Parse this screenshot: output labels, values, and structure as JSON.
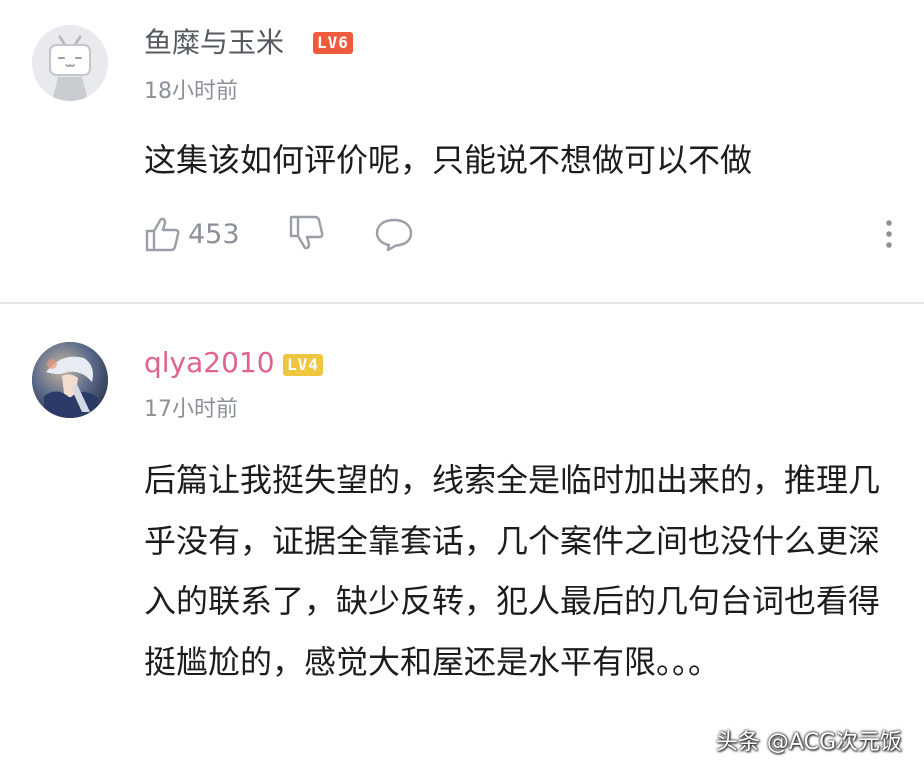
{
  "comments": [
    {
      "username": "鱼糜与玉米",
      "level": "LV6",
      "level_color": "#ef5b3c",
      "username_color": "#555a61",
      "avatar_icon": "bilibili-tv-avatar-icon",
      "timestamp": "18小时前",
      "text": "这集该如何评价呢，只能说不想做可以不做",
      "likes": "453",
      "actions": [
        "like-icon",
        "dislike-icon",
        "reply-icon",
        "more-icon"
      ]
    },
    {
      "username": "qlya2010",
      "level": "LV4",
      "level_color": "#efc640",
      "username_color": "#e0628f",
      "avatar_icon": "anime-character-avatar",
      "timestamp": "17小时前",
      "text": "后篇让我挺失望的，线索全是临时加出来的，推理几乎没有，证据全靠套话，几个案件之间也没什么更深入的联系了，缺少反转，犯人最后的几句台词也看得挺尴尬的，感觉大和屋还是水平有限。。。"
    }
  ],
  "watermark": "头条 @ACG次元饭"
}
